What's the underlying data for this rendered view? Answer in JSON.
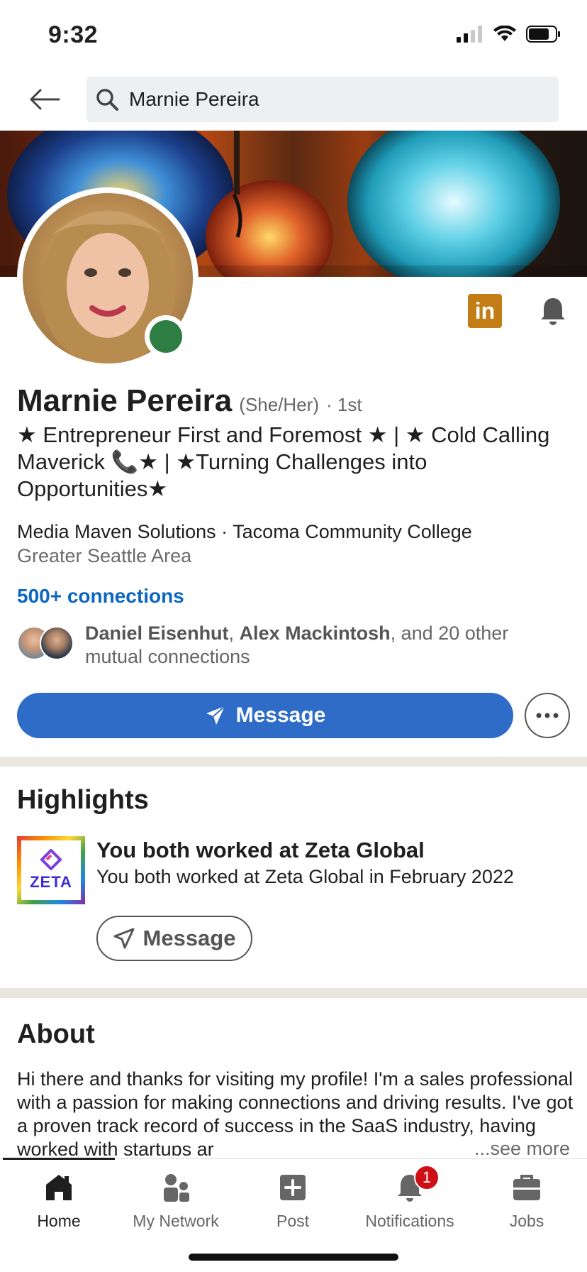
{
  "status_bar": {
    "time": "9:32"
  },
  "search": {
    "value": "Marnie Pereira"
  },
  "profile": {
    "name": "Marnie Pereira",
    "pronouns": "(She/Her)",
    "degree": "· 1st",
    "headline": "★ Entrepreneur First and Foremost ★ | ★ Cold Calling Maverick 📞★ | ★Turning Challenges into Opportunities★",
    "company_line": "Media Maven Solutions · Tacoma Community College",
    "location": "Greater Seattle Area",
    "connections": "500+ connections",
    "mutual": {
      "name1": "Daniel Eisenhut",
      "separator": ", ",
      "name2": "Alex Mackintosh",
      "rest": ", and 20 other mutual connections"
    },
    "message_button": "Message",
    "linkedin_badge": "in"
  },
  "highlights": {
    "title": "Highlights",
    "logo_text": "ZETA",
    "item_title": "You both worked at Zeta Global",
    "item_subtitle": "You both worked at Zeta Global in February 2022",
    "message_button": "Message"
  },
  "about": {
    "title": "About",
    "text": "Hi there and thanks for visiting my profile! I'm a sales professional with a passion for making connections and driving results. I've got a proven track record of success in the SaaS industry, having worked with startups ar",
    "see_more": "...see more"
  },
  "bottom_nav": {
    "items": [
      {
        "label": "Home",
        "icon": "home-icon"
      },
      {
        "label": "My Network",
        "icon": "network-icon"
      },
      {
        "label": "Post",
        "icon": "post-icon"
      },
      {
        "label": "Notifications",
        "icon": "bell-icon",
        "badge": "1"
      },
      {
        "label": "Jobs",
        "icon": "briefcase-icon"
      }
    ]
  },
  "colors": {
    "primary": "#2f6cc8",
    "link": "#0a66c2",
    "online": "#2e7d43",
    "badge": "#cc1016",
    "linkedin_badge": "#c37d16",
    "divider": "#e8e6df"
  }
}
